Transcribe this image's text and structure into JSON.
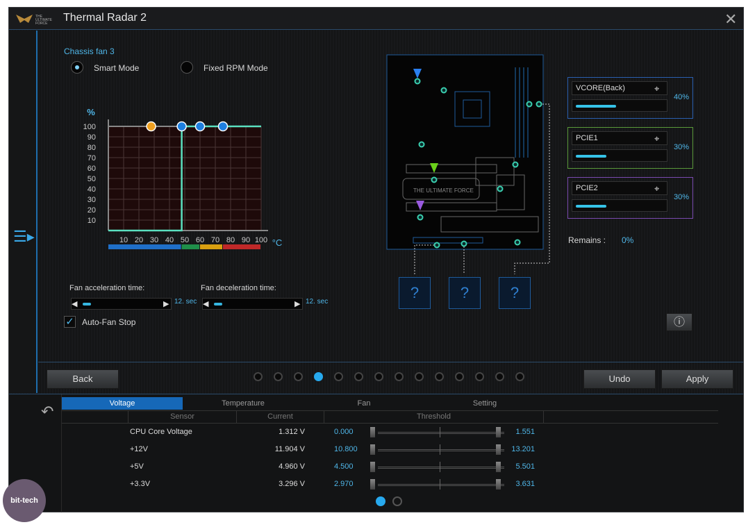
{
  "window": {
    "title": "Thermal Radar 2",
    "logo_text": "THE ULTIMATE FORCE"
  },
  "fan": {
    "name": "Chassis fan 3",
    "modes": [
      {
        "label": "Smart Mode",
        "selected": true
      },
      {
        "label": "Fixed RPM Mode",
        "selected": false
      }
    ],
    "accel_label": "Fan acceleration time:",
    "accel_value": "12. sec",
    "decel_label": "Fan deceleration time:",
    "decel_value": "12. sec",
    "auto_stop_label": "Auto-Fan Stop",
    "auto_stop_checked": true
  },
  "chart_data": {
    "type": "line",
    "ylabel": "%",
    "xlabel": "°C",
    "xlim": [
      0,
      100
    ],
    "ylim": [
      0,
      100
    ],
    "x_ticks": [
      10,
      20,
      30,
      40,
      50,
      60,
      70,
      80,
      90,
      100
    ],
    "y_ticks": [
      10,
      20,
      30,
      40,
      50,
      60,
      70,
      80,
      90,
      100
    ],
    "grid": true,
    "curve": [
      [
        0,
        0
      ],
      [
        48,
        0
      ],
      [
        48,
        100
      ],
      [
        100,
        100
      ]
    ],
    "points": [
      {
        "x": 28,
        "y": 100,
        "color": "#f0a020"
      },
      {
        "x": 48,
        "y": 100,
        "color": "#1e7fe0"
      },
      {
        "x": 60,
        "y": 100,
        "color": "#1e7fe0"
      },
      {
        "x": 75,
        "y": 100,
        "color": "#1e7fe0"
      }
    ],
    "zones": [
      {
        "from": 0,
        "to": 48,
        "color": "#1f6fc8"
      },
      {
        "from": 48,
        "to": 60,
        "color": "#1f8f4a"
      },
      {
        "from": 60,
        "to": 75,
        "color": "#d9a010"
      },
      {
        "from": 75,
        "to": 100,
        "color": "#c02828"
      }
    ]
  },
  "sources": [
    {
      "name": "VCORE(Back)",
      "percent": "40%",
      "fill": 40,
      "border": "#2a5fb0"
    },
    {
      "name": "PCIE1",
      "percent": "30%",
      "fill": 30,
      "border": "#5a9a3a"
    },
    {
      "name": "PCIE2",
      "percent": "30%",
      "fill": 30,
      "border": "#7a4ab0"
    }
  ],
  "remains": {
    "label": "Remains :",
    "value": "0%"
  },
  "pages": {
    "count": 14,
    "active": 3
  },
  "buttons": {
    "back": "Back",
    "undo": "Undo",
    "apply": "Apply"
  },
  "monitor": {
    "tabs": [
      "Voltage",
      "Temperature",
      "Fan",
      "Setting"
    ],
    "active_tab": 0,
    "columns": [
      "Sensor",
      "Current",
      "Threshold"
    ],
    "rows": [
      {
        "sensor": "CPU Core Voltage",
        "current": "1.312 V",
        "min": "0.000",
        "max": "1.551"
      },
      {
        "sensor": "+12V",
        "current": "11.904 V",
        "min": "10.800",
        "max": "13.201"
      },
      {
        "sensor": "+5V",
        "current": "4.960 V",
        "min": "4.500",
        "max": "5.501"
      },
      {
        "sensor": "+3.3V",
        "current": "3.296 V",
        "min": "2.970",
        "max": "3.631"
      }
    ],
    "pages": 2,
    "active_page": 0
  },
  "watermark": "bit-tech.net"
}
